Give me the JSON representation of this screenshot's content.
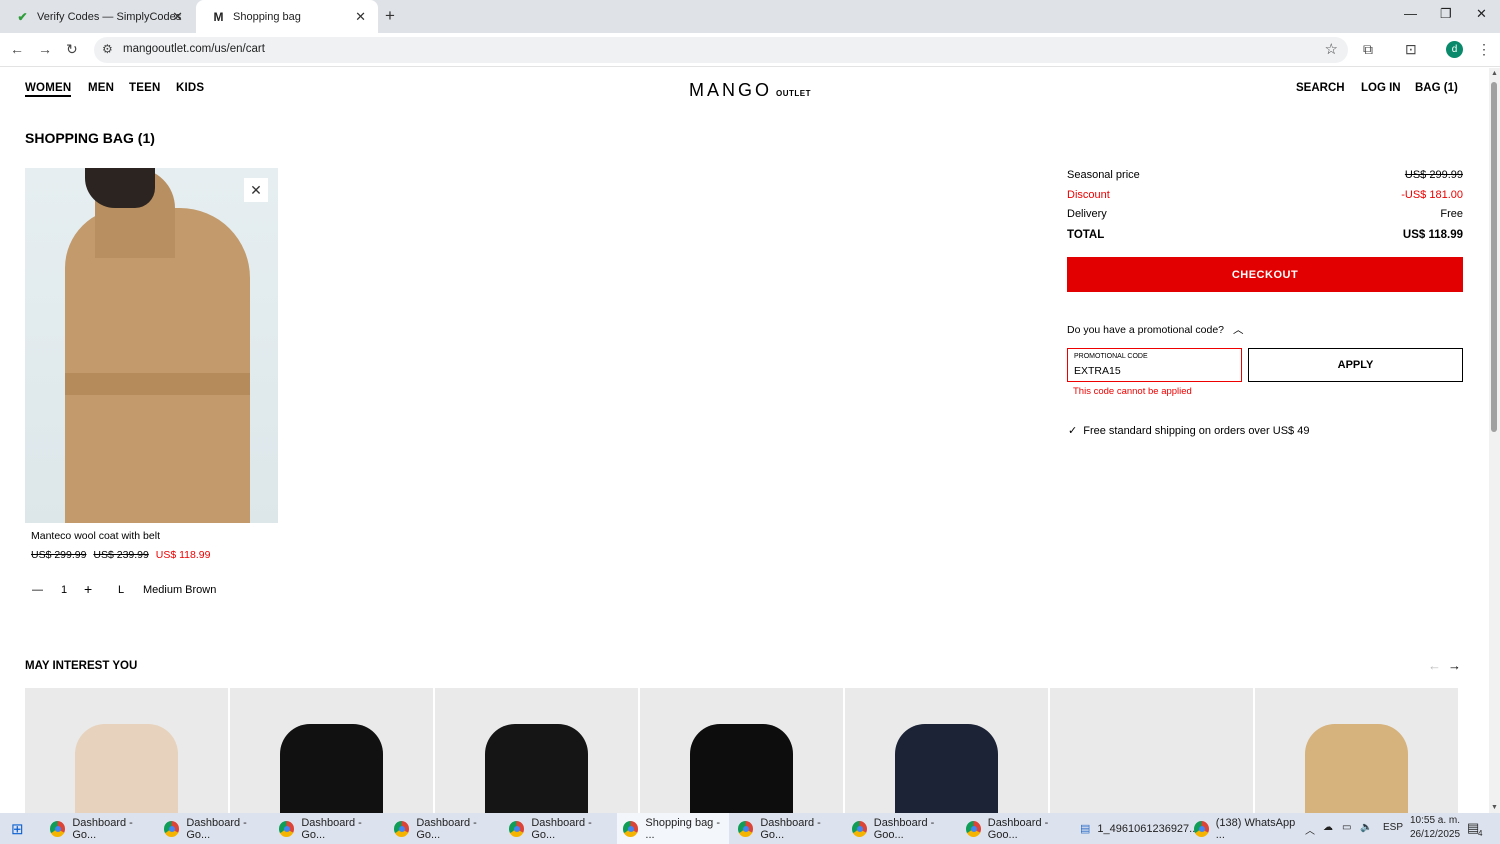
{
  "browser": {
    "tabs": [
      {
        "title": "Verify Codes — SimplyCodes",
        "icon": "simplycodes-icon"
      },
      {
        "title": "Shopping bag",
        "icon": "mango-icon"
      }
    ],
    "url": "mangooutlet.com/us/en/cart",
    "profile_initial": "d"
  },
  "header": {
    "nav": [
      "WOMEN",
      "MEN",
      "TEEN",
      "KIDS"
    ],
    "logo": "MANGO",
    "logo_sub": "OUTLET",
    "right": [
      "SEARCH",
      "LOG IN",
      "BAG (1)"
    ]
  },
  "bag": {
    "title": "SHOPPING BAG (1)",
    "item": {
      "name": "Manteco wool coat with belt",
      "price_original": "US$ 299.99",
      "price_previous": "US$ 239.99",
      "price_sale": "US$ 118.99",
      "quantity": "1",
      "size": "L",
      "color": "Medium Brown"
    }
  },
  "summary": {
    "seasonal_label": "Seasonal price",
    "seasonal_value": "US$ 299.99",
    "discount_label": "Discount",
    "discount_value": "-US$ 181.00",
    "delivery_label": "Delivery",
    "delivery_value": "Free",
    "total_label": "TOTAL",
    "total_value": "US$ 118.99",
    "checkout": "CHECKOUT",
    "promo_question": "Do you have a promotional code?",
    "promo_label": "PROMOTIONAL CODE",
    "promo_value": "EXTRA15",
    "apply": "APPLY",
    "promo_error": "This code cannot be applied",
    "shipping_note": "Free standard shipping on orders over US$ 49"
  },
  "recommend": {
    "title": "MAY INTEREST YOU",
    "cards": [
      "#e7d3bd",
      "#111111",
      "#151515",
      "#0d0d0d",
      "#1d2336",
      "",
      "#d6b27c"
    ]
  },
  "taskbar": {
    "items": [
      "Dashboard - Go...",
      "Dashboard - Go...",
      "Dashboard - Go...",
      "Dashboard - Go...",
      "Dashboard - Go...",
      "Shopping bag - ...",
      "Dashboard - Go...",
      "Dashboard - Goo...",
      "Dashboard - Goo...",
      "1_4961061236927...",
      "(138) WhatsApp ..."
    ],
    "lang": "ESP",
    "time": "10:55 a. m.",
    "date": "26/12/2025",
    "notif_count": "4"
  },
  "colors": {
    "accent_red": "#e20000"
  }
}
